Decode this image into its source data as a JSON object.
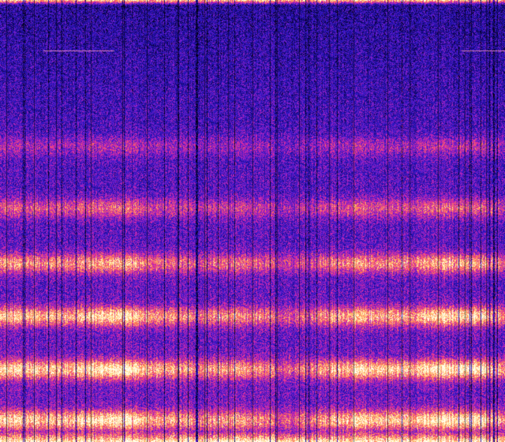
{
  "image": {
    "kind": "spectrogram",
    "colormap": [
      "#000010",
      "#1a0a8a",
      "#3018c8",
      "#8a20c8",
      "#e02aa0",
      "#ff7a50",
      "#ffe08a",
      "#fffff0"
    ],
    "bands": [
      {
        "level": 0.95,
        "intensity": 0.95
      },
      {
        "level": 0.835,
        "intensity": 1.0
      },
      {
        "level": 0.715,
        "intensity": 0.92
      },
      {
        "level": 0.595,
        "intensity": 0.78
      },
      {
        "level": 0.47,
        "intensity": 0.55
      },
      {
        "level": 0.33,
        "intensity": 0.35
      }
    ],
    "top_edge_intensity": 0.9,
    "bottom_edge_intensity": 1.0
  }
}
